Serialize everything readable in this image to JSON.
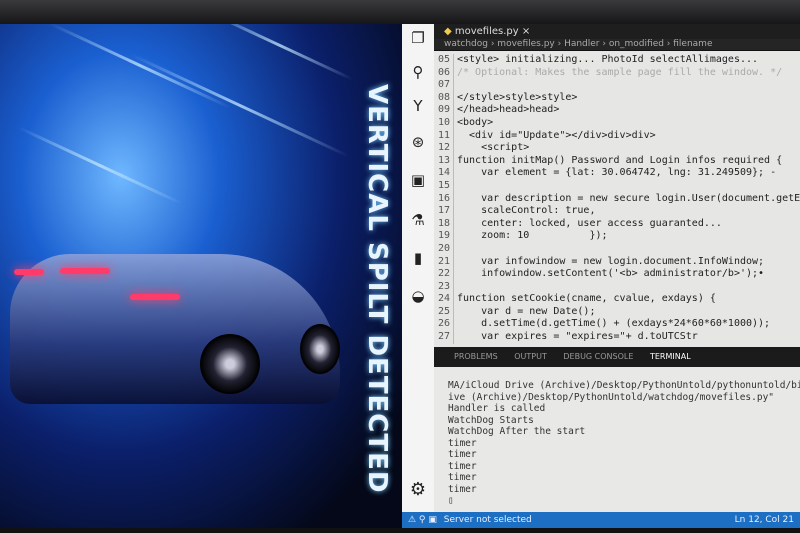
{
  "image": {
    "overlay_text": "VERTICAL SPILT DETECTED"
  },
  "activity_bar": {
    "icons": [
      "files-icon",
      "search-icon",
      "source-control-icon",
      "debug-icon",
      "extensions-icon",
      "flask-icon",
      "bookmark-icon",
      "docker-icon",
      "gear-icon"
    ]
  },
  "editor": {
    "tab": "movefiles.py",
    "tab_close": "×",
    "breadcrumb": "watchdog › movefiles.py › Handler › on_modified › filename",
    "lines": [
      {
        "n": "05",
        "t": "<style> initializing... PhotoId selectAllimages..."
      },
      {
        "n": "06",
        "t": "/* Optional: Makes the sample page fill the window. */"
      },
      {
        "n": "07",
        "t": ""
      },
      {
        "n": "08",
        "t": "</style>style>style>"
      },
      {
        "n": "09",
        "t": "</head>head>head>"
      },
      {
        "n": "10",
        "t": "<body>"
      },
      {
        "n": "11",
        "t": "  <div id=\"Update\"></div>div>div>"
      },
      {
        "n": "12",
        "t": "    <script>"
      },
      {
        "n": "13",
        "t": "function initMap() Password and Login infos required {"
      },
      {
        "n": "14",
        "t": "    var element = {lat: 30.064742, lng: 31.249509}; -"
      },
      {
        "n": "15",
        "t": ""
      },
      {
        "n": "16",
        "t": "    var description = new secure login.User(document.getElement"
      },
      {
        "n": "17",
        "t": "    scaleControl: true,"
      },
      {
        "n": "18",
        "t": "    center: locked, user access guaranted..."
      },
      {
        "n": "19",
        "t": "    zoom: 10          });"
      },
      {
        "n": "20",
        "t": ""
      },
      {
        "n": "21",
        "t": "    var infowindow = new login.document.InfoWindow;"
      },
      {
        "n": "22",
        "t": "    infowindow.setContent('<b> administrator/b>');•"
      },
      {
        "n": "23",
        "t": ""
      },
      {
        "n": "24",
        "t": "function setCookie(cname, cvalue, exdays) {"
      },
      {
        "n": "25",
        "t": "    var d = new Date();"
      },
      {
        "n": "26",
        "t": "    d.setTime(d.getTime() + (exdays*24*60*60*1000));"
      },
      {
        "n": "27",
        "t": "    var expires = \"expires=\"+ d.toUTCStr"
      }
    ]
  },
  "panel": {
    "tabs": [
      "PROBLEMS",
      "OUTPUT",
      "DEBUG CONSOLE",
      "TERMINAL"
    ],
    "active_tab": "TERMINAL",
    "terminal": [
      "MA/iCloud Drive (Archive)/Desktop/PythonUntold/pythonuntold/bin/pytho",
      "ive (Archive)/Desktop/PythonUntold/watchdog/movefiles.py\"",
      "Handler is called",
      "WatchDog Starts",
      "WatchDog After the start",
      "timer",
      "timer",
      "timer",
      "timer",
      "timer",
      "▯"
    ]
  },
  "status_bar": {
    "server": "Server not selected",
    "position": "Ln 12, Col 21",
    "color": "#1d6fc4"
  }
}
